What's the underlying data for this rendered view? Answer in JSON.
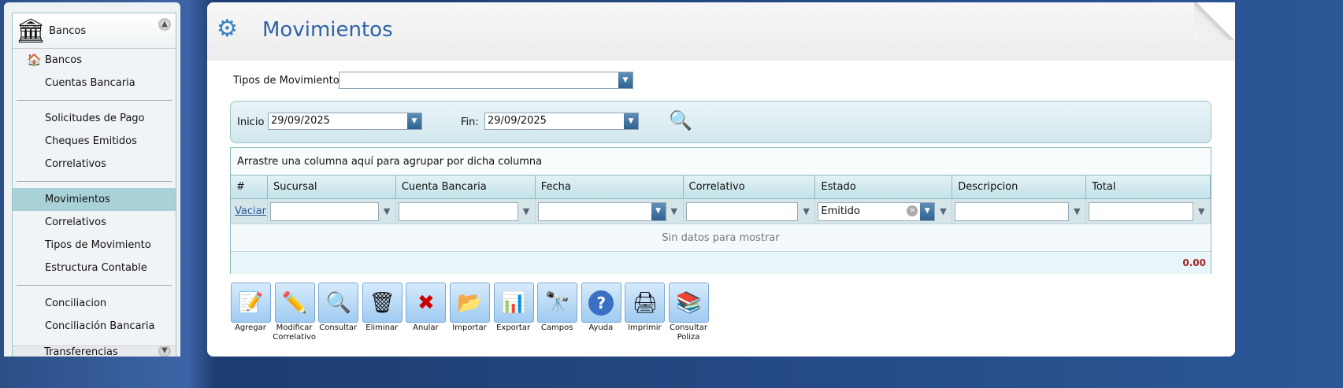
{
  "sidebar": {
    "header": "Bancos",
    "items": [
      {
        "label": "Bancos",
        "icon": "bank-building-icon"
      },
      {
        "label": "Cuentas Bancaria"
      },
      {
        "label": "Solicitudes de Pago"
      },
      {
        "label": "Cheques Emitidos"
      },
      {
        "label": "Correlativos"
      },
      {
        "label": "Movimientos",
        "active": true
      },
      {
        "label": "Correlativos"
      },
      {
        "label": "Tipos de Movimiento"
      },
      {
        "label": "Estructura Contable"
      },
      {
        "label": "Conciliacion"
      },
      {
        "label": "Conciliación Bancaria"
      }
    ],
    "footer": "Transferencias"
  },
  "page": {
    "title": "Movimientos"
  },
  "filters": {
    "tipo_label": "Tipos de Movimiento",
    "tipo_value": "",
    "inicio_label": "Inicio",
    "inicio_value": "29/09/2025",
    "fin_label": "Fin:",
    "fin_value": "29/09/2025"
  },
  "grid": {
    "group_hint": "Arrastre una columna aquí para agrupar por dicha columna",
    "columns": [
      "#",
      "Sucursal",
      "Cuenta Bancaria",
      "Fecha",
      "Correlativo",
      "Estado",
      "Descripcion",
      "Total"
    ],
    "clear_link": "Vaciar",
    "estado_filter": "Emitido",
    "empty_text": "Sin datos para mostrar",
    "total": "0.00"
  },
  "toolbar": [
    {
      "label": "Agregar",
      "icon": "📝"
    },
    {
      "label": "Modificar Correlativo",
      "icon": "✏️"
    },
    {
      "label": "Consultar",
      "icon": "🔍"
    },
    {
      "label": "Eliminar",
      "icon": "🗑"
    },
    {
      "label": "Anular",
      "icon": "✖"
    },
    {
      "label": "Importar",
      "icon": "📂"
    },
    {
      "label": "Exportar",
      "icon": "📊"
    },
    {
      "label": "Campos",
      "icon": "🔭"
    },
    {
      "label": "Ayuda",
      "icon": "?"
    },
    {
      "label": "Imprimir",
      "icon": "🖨"
    },
    {
      "label": "Consultar Poliza",
      "icon": "📚"
    }
  ],
  "colors": {
    "accent": "#2f63a9",
    "total": "#a1232b",
    "active_item": "#a8d2d8"
  }
}
